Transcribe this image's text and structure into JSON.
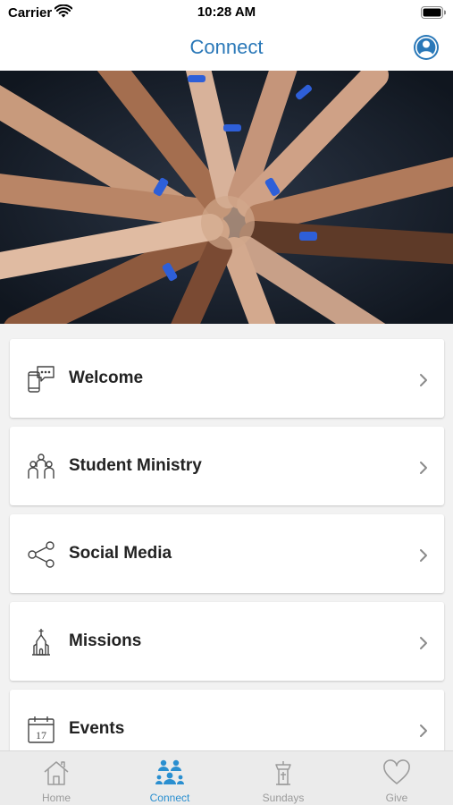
{
  "status_bar": {
    "carrier": "Carrier",
    "time": "10:28 AM"
  },
  "nav": {
    "title": "Connect",
    "profile_icon": "user-profile-icon"
  },
  "hero": {
    "icon": "hands-together-photo"
  },
  "menu": {
    "items": [
      {
        "label": "Welcome",
        "icon": "phone-chat-icon"
      },
      {
        "label": "Student Ministry",
        "icon": "people-group-icon"
      },
      {
        "label": "Social Media",
        "icon": "share-icon"
      },
      {
        "label": "Missions",
        "icon": "church-icon"
      },
      {
        "label": "Events",
        "icon": "calendar-icon",
        "icon_text": "17"
      }
    ]
  },
  "tabs": {
    "items": [
      {
        "label": "Home",
        "icon": "house-icon"
      },
      {
        "label": "Connect",
        "icon": "connect-people-icon",
        "active": true
      },
      {
        "label": "Sundays",
        "icon": "pulpit-icon"
      },
      {
        "label": "Give",
        "icon": "heart-icon"
      }
    ]
  },
  "colors": {
    "accent": "#2a78b8",
    "tab_active": "#2a8fd0",
    "tab_inactive": "#9b9b9b",
    "background": "#f2f2f2"
  }
}
